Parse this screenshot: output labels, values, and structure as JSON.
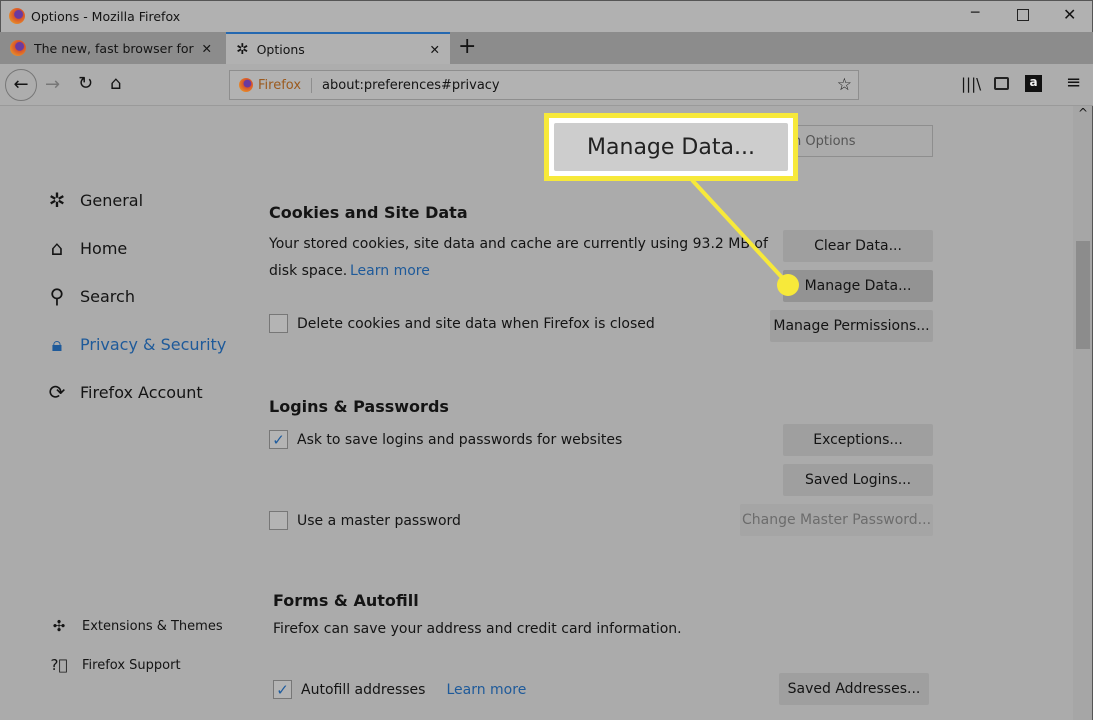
{
  "window": {
    "title": "Options - Mozilla Firefox"
  },
  "tabs": [
    {
      "label": "The new, fast browser for Mac,",
      "icon": "firefox-icon"
    },
    {
      "label": "Options",
      "icon": "gear-icon",
      "active": true
    }
  ],
  "urlbar": {
    "identity": "Firefox",
    "url": "about:preferences#privacy"
  },
  "sidebar": {
    "items": [
      {
        "label": "General",
        "icon": "gear-icon"
      },
      {
        "label": "Home",
        "icon": "home-icon"
      },
      {
        "label": "Search",
        "icon": "search-icon"
      },
      {
        "label": "Privacy & Security",
        "icon": "lock-icon",
        "active": true
      },
      {
        "label": "Firefox Account",
        "icon": "sync-icon"
      }
    ],
    "footer": [
      {
        "label": "Extensions & Themes",
        "icon": "puzzle-icon"
      },
      {
        "label": "Firefox Support",
        "icon": "help-icon"
      }
    ]
  },
  "callout": {
    "label": "Manage Data...",
    "partial_behind": "n Options",
    "color": "#f7e93a"
  },
  "cookies": {
    "title": "Cookies and Site Data",
    "desc1": "Your stored cookies, site data and cache are currently using 93.2 MB of",
    "desc2": "disk space.",
    "learn_more": "Learn more",
    "checkbox": "Delete cookies and site data when Firefox is closed",
    "clear": "Clear Data...",
    "manage": "Manage Data...",
    "permissions": "Manage Permissions..."
  },
  "logins": {
    "title": "Logins & Passwords",
    "ask": "Ask to save logins and passwords for websites",
    "master": "Use a master password",
    "exceptions": "Exceptions...",
    "saved": "Saved Logins...",
    "change_master": "Change Master Password..."
  },
  "forms": {
    "title": "Forms & Autofill",
    "desc": "Firefox can save your address and credit card information.",
    "autofill": "Autofill addresses",
    "learn_more": "Learn more",
    "saved_addresses": "Saved Addresses..."
  },
  "colors": {
    "accent": "#1e5a9a",
    "highlight": "#f7e93a"
  }
}
